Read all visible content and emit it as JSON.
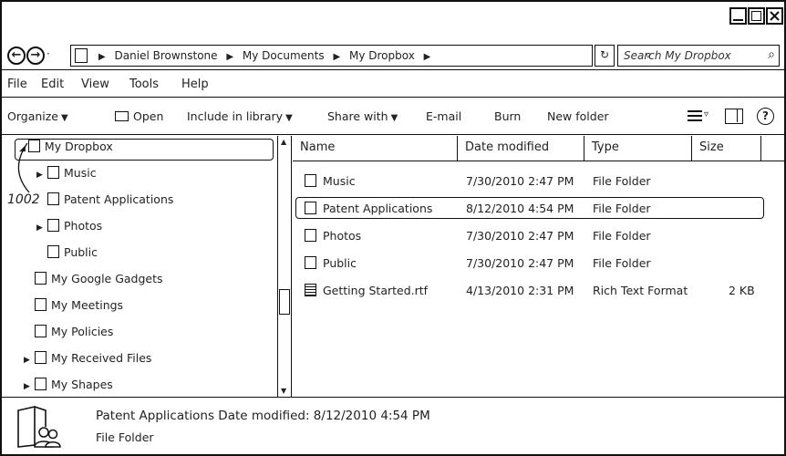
{
  "address": {
    "crumbs": [
      "Daniel Brownstone",
      "My Documents",
      "My Dropbox"
    ],
    "search_placeholder": "Search My Dropbox"
  },
  "menu": [
    "File",
    "Edit",
    "View",
    "Tools",
    "Help"
  ],
  "toolbar": {
    "organize": "Organize",
    "open": "Open",
    "include": "Include in library",
    "share": "Share with",
    "email": "E-mail",
    "burn": "Burn",
    "new_folder": "New folder"
  },
  "tree": {
    "root": "My Dropbox",
    "items": [
      {
        "label": "Music",
        "expandable": true
      },
      {
        "label": "Patent Applications",
        "expandable": false
      },
      {
        "label": "Photos",
        "expandable": true
      },
      {
        "label": "Public",
        "expandable": false
      },
      {
        "label": "My Google Gadgets",
        "expandable": false
      },
      {
        "label": "My Meetings",
        "expandable": false
      },
      {
        "label": "My Policies",
        "expandable": false
      },
      {
        "label": "My Received Files",
        "expandable": true
      },
      {
        "label": "My Shapes",
        "expandable": true
      }
    ],
    "annotation": "1002"
  },
  "columns": {
    "name": "Name",
    "date": "Date modified",
    "type": "Type",
    "size": "Size"
  },
  "files": [
    {
      "name": "Music",
      "date": "7/30/2010 2:47 PM",
      "type": "File Folder",
      "size": ""
    },
    {
      "name": "Patent Applications",
      "date": "8/12/2010 4:54 PM",
      "type": "File Folder",
      "size": ""
    },
    {
      "name": "Photos",
      "date": "7/30/2010 2:47 PM",
      "type": "File Folder",
      "size": ""
    },
    {
      "name": "Public",
      "date": "7/30/2010 2:47 PM",
      "type": "File Folder",
      "size": ""
    },
    {
      "name": "Getting Started.rtf",
      "date": "4/13/2010 2:31 PM",
      "type": "Rich Text Format",
      "size": "2 KB"
    }
  ],
  "details": {
    "line1": "Patent Applications Date modified: 8/12/2010 4:54 PM",
    "line2": "File Folder"
  },
  "icons": {
    "back": "back-arrow-icon",
    "forward": "forward-arrow-icon",
    "search": "magnifier-icon",
    "refresh": "refresh-icon",
    "help": "help-icon"
  }
}
